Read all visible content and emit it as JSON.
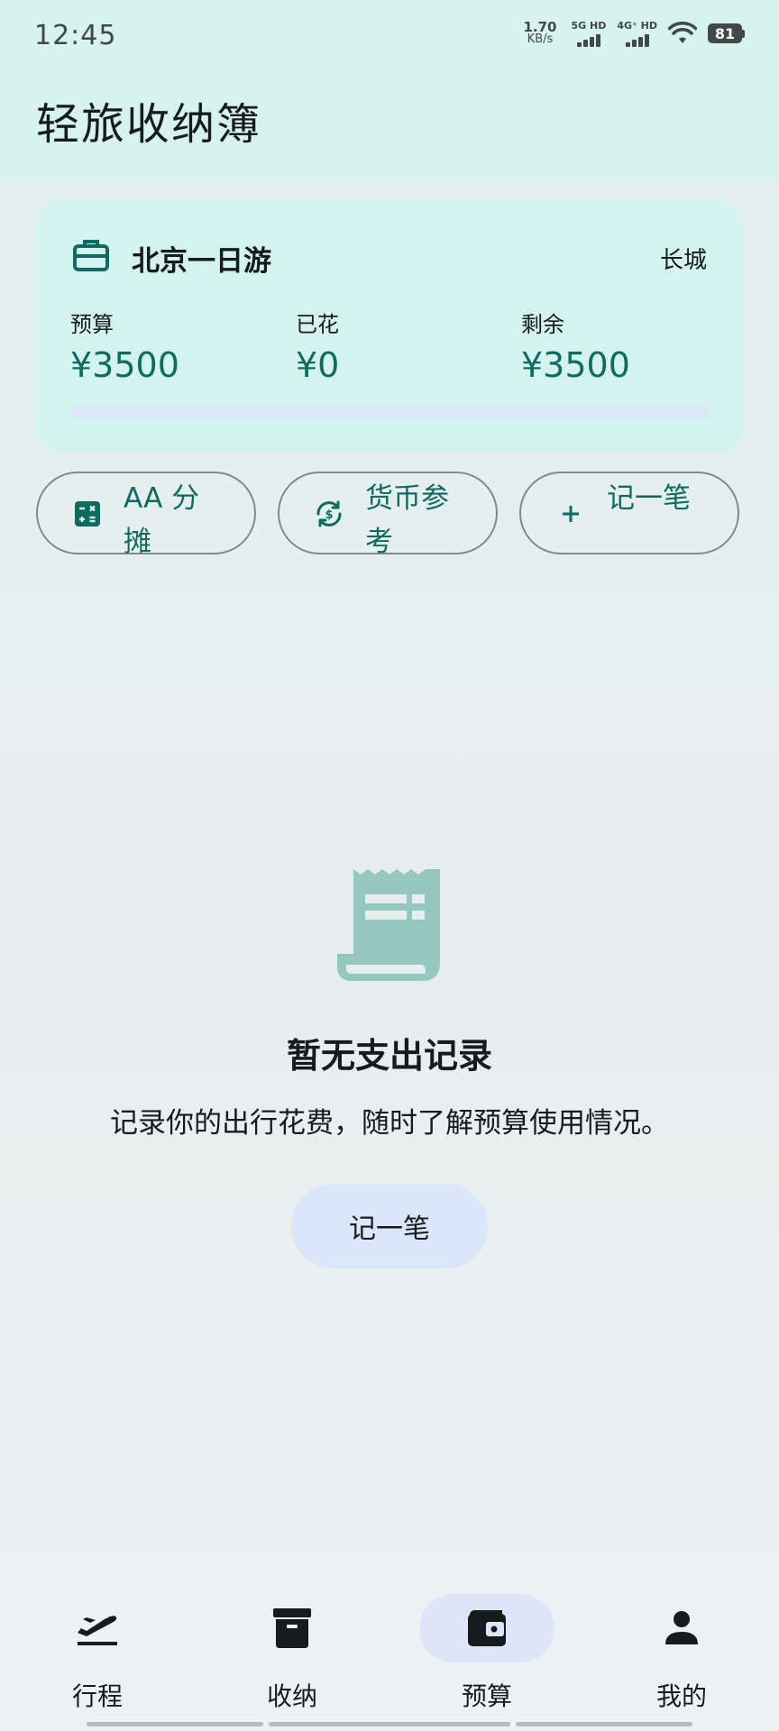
{
  "status_bar": {
    "time": "12:45",
    "net_speed": "1.70",
    "net_unit": "KB/s",
    "sim1": "5G HD",
    "sim2": "4G⁺ HD",
    "battery": "81"
  },
  "app": {
    "title": "轻旅收纳簿"
  },
  "trip_card": {
    "icon": "briefcase-icon",
    "name": "北京一日游",
    "destination": "长城",
    "budget_label": "预算",
    "budget_value": "¥3500",
    "spent_label": "已花",
    "spent_value": "¥0",
    "remaining_label": "剩余",
    "remaining_value": "¥3500",
    "spent_fraction": 0
  },
  "actions": [
    {
      "icon": "calculator-icon",
      "label": "AA 分摊"
    },
    {
      "icon": "currency-exchange-icon",
      "label": "货币参考"
    },
    {
      "icon": "plus-icon",
      "label": "记一笔"
    }
  ],
  "empty_state": {
    "icon": "receipt-icon",
    "title": "暂无支出记录",
    "subtitle": "记录你的出行花费，随时了解预算使用情况。",
    "button_label": "记一笔"
  },
  "bottom_nav": {
    "active_index": 2,
    "items": [
      {
        "icon": "flight-takeoff-icon",
        "label": "行程"
      },
      {
        "icon": "archive-box-icon",
        "label": "收纳"
      },
      {
        "icon": "wallet-icon",
        "label": "预算"
      },
      {
        "icon": "person-icon",
        "label": "我的"
      }
    ]
  },
  "colors": {
    "accent": "#0f6b61",
    "header_bg": "#d6f3ee",
    "card_bg": "#d5f3ee",
    "tonal_button_bg": "#dce6fb"
  }
}
